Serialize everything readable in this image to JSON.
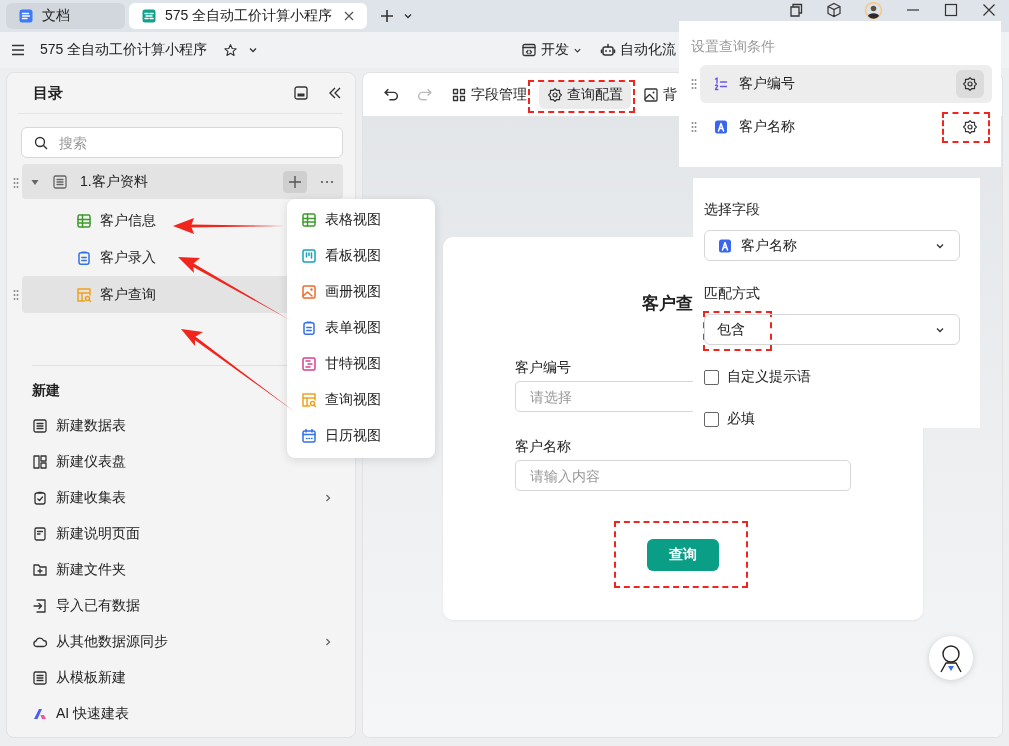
{
  "browser_tabs": [
    {
      "label": "文档",
      "kind": "doc",
      "selected": false
    },
    {
      "label": "575 全自动工价计算小程序",
      "kind": "app",
      "selected": true
    }
  ],
  "app_header": {
    "title": "575 全自动工价计算小程序",
    "menus": [
      {
        "label": "开发",
        "kind": "dev"
      },
      {
        "label": "自动化流",
        "kind": "robot"
      }
    ]
  },
  "sidebar": {
    "title": "目录",
    "search": {
      "placeholder": "搜索"
    },
    "tree": [
      {
        "label": "1.客户资料",
        "expanded": true,
        "children": [
          {
            "label": "客户信息",
            "kind": "grid",
            "selected": false
          },
          {
            "label": "客户录入",
            "kind": "form",
            "selected": false
          },
          {
            "label": "客户查询",
            "kind": "query",
            "selected": true
          }
        ]
      }
    ],
    "new_section": {
      "title": "新建",
      "items": [
        {
          "label": "新建数据表",
          "kind": "table",
          "submenu": false
        },
        {
          "label": "新建仪表盘",
          "kind": "dashboard",
          "submenu": false
        },
        {
          "label": "新建收集表",
          "kind": "collect",
          "submenu": true
        },
        {
          "label": "新建说明页面",
          "kind": "page",
          "submenu": false
        },
        {
          "label": "新建文件夹",
          "kind": "folder",
          "submenu": false
        },
        {
          "label": "导入已有数据",
          "kind": "import",
          "submenu": false
        },
        {
          "label": "从其他数据源同步",
          "kind": "cloud",
          "submenu": true
        },
        {
          "label": "从模板新建",
          "kind": "table",
          "submenu": false
        },
        {
          "label": "AI 快速建表",
          "kind": "ai",
          "submenu": false
        }
      ]
    }
  },
  "view_menu": [
    {
      "label": "表格视图",
      "kind": "grid"
    },
    {
      "label": "看板视图",
      "kind": "kanban"
    },
    {
      "label": "画册视图",
      "kind": "gallery"
    },
    {
      "label": "表单视图",
      "kind": "form"
    },
    {
      "label": "甘特视图",
      "kind": "gantt"
    },
    {
      "label": "查询视图",
      "kind": "query"
    },
    {
      "label": "日历视图",
      "kind": "calendar"
    }
  ],
  "toolbar": {
    "items": [
      {
        "label": "字段管理",
        "kind": "fields",
        "selected": false
      },
      {
        "label": "查询配置",
        "kind": "settings",
        "selected": true
      },
      {
        "label": "背",
        "kind": "image",
        "selected": false
      }
    ]
  },
  "query_form": {
    "title": "客户查",
    "fields": [
      {
        "label": "客户编号",
        "placeholder": "请选择"
      },
      {
        "label": "客户名称",
        "placeholder": "请输入内容"
      }
    ],
    "submit": "查询"
  },
  "conditions_panel": {
    "title": "设置查询条件",
    "conditions": [
      {
        "label": "客户编号",
        "kind": "number",
        "selected": true
      },
      {
        "label": "客户名称",
        "kind": "text",
        "selected": false
      }
    ]
  },
  "field_settings": {
    "field_label": "选择字段",
    "field_select": {
      "value": "客户名称",
      "kind": "text"
    },
    "match_label": "匹配方式",
    "match_select": {
      "value": "包含"
    },
    "options": [
      {
        "label": "自定义提示语",
        "checked": false
      },
      {
        "label": "必填",
        "checked": false
      }
    ]
  }
}
